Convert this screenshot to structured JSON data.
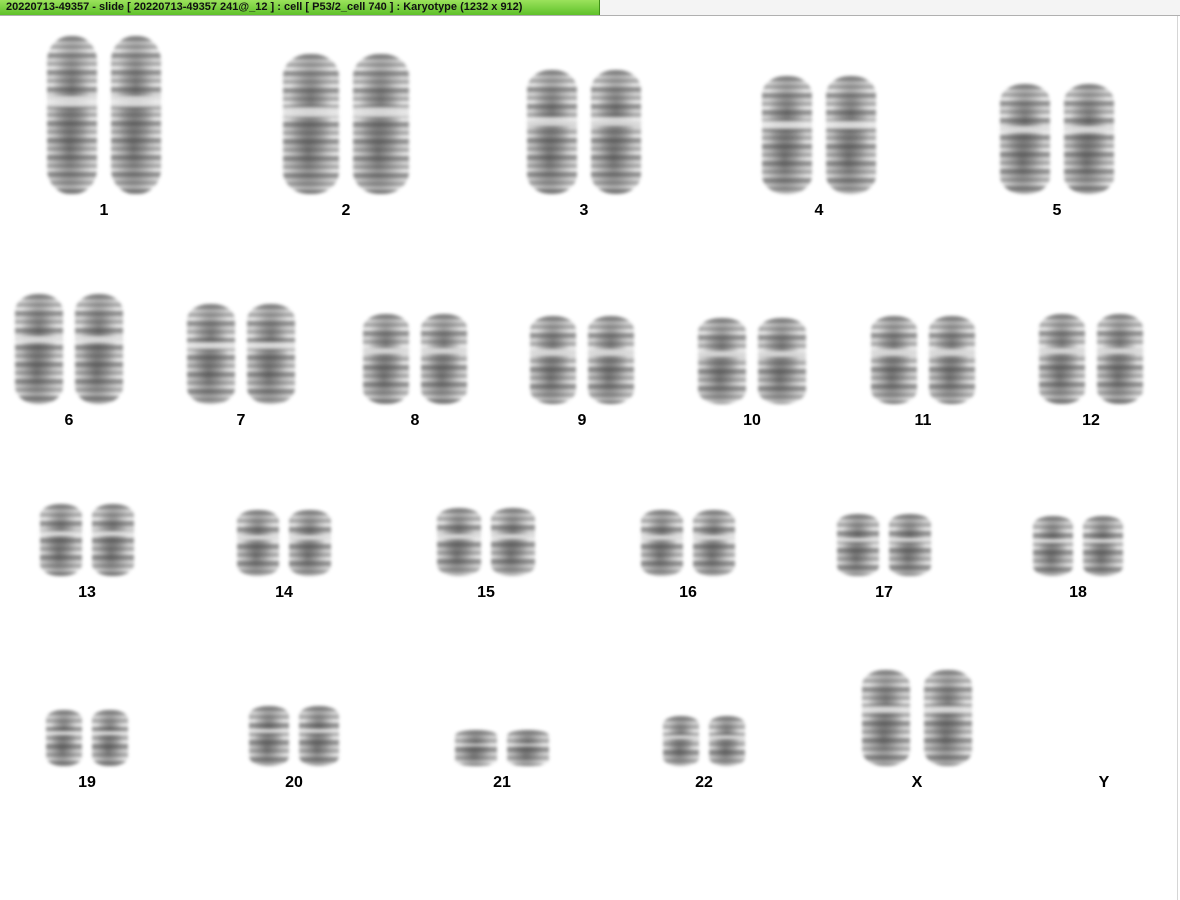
{
  "window": {
    "title": "20220713-49357 - slide [ 20220713-49357 241@_12 ] : cell [ P53/2_cell 740 ] : Karyotype  (1232 x 912)"
  },
  "karyotype": {
    "chromosomes": [
      {
        "label": "1",
        "homologs": 2
      },
      {
        "label": "2",
        "homologs": 2
      },
      {
        "label": "3",
        "homologs": 2
      },
      {
        "label": "4",
        "homologs": 2
      },
      {
        "label": "5",
        "homologs": 2
      },
      {
        "label": "6",
        "homologs": 2
      },
      {
        "label": "7",
        "homologs": 2
      },
      {
        "label": "8",
        "homologs": 2
      },
      {
        "label": "9",
        "homologs": 2
      },
      {
        "label": "10",
        "homologs": 2
      },
      {
        "label": "11",
        "homologs": 2
      },
      {
        "label": "12",
        "homologs": 2
      },
      {
        "label": "13",
        "homologs": 2
      },
      {
        "label": "14",
        "homologs": 2
      },
      {
        "label": "15",
        "homologs": 2
      },
      {
        "label": "16",
        "homologs": 2
      },
      {
        "label": "17",
        "homologs": 2
      },
      {
        "label": "18",
        "homologs": 2
      },
      {
        "label": "19",
        "homologs": 2
      },
      {
        "label": "20",
        "homologs": 2
      },
      {
        "label": "21",
        "homologs": 2
      },
      {
        "label": "22",
        "homologs": 2
      },
      {
        "label": "X",
        "homologs": 2
      },
      {
        "label": "Y",
        "homologs": 0
      }
    ]
  }
}
